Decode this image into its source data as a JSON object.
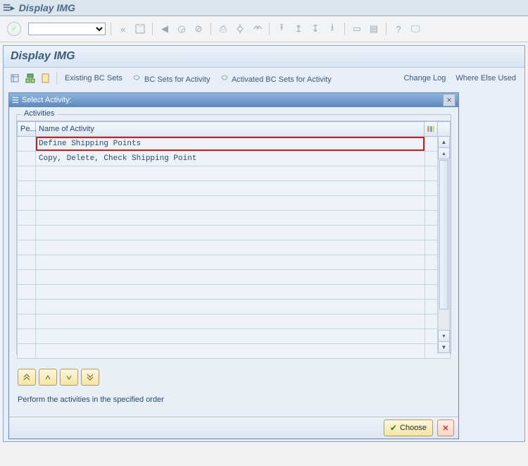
{
  "window": {
    "title": "Display IMG"
  },
  "panel": {
    "title": "Display IMG",
    "toolbar": {
      "existing": "Existing BC Sets",
      "bcsets": "BC Sets for Activity",
      "activated": "Activated BC Sets for Activity",
      "changelog": "Change Log",
      "whereelse": "Where Else Used"
    }
  },
  "dialog": {
    "title": "Select Activity:",
    "group": "Activities",
    "cols": {
      "pe": "Pe...",
      "name": "Name of Activity"
    },
    "rows": [
      {
        "name": "Define Shipping Points",
        "highlight": true
      },
      {
        "name": "Copy, Delete, Check Shipping Point",
        "highlight": false
      }
    ],
    "instruction": "Perform the activities in the specified order",
    "choose": "Choose"
  }
}
